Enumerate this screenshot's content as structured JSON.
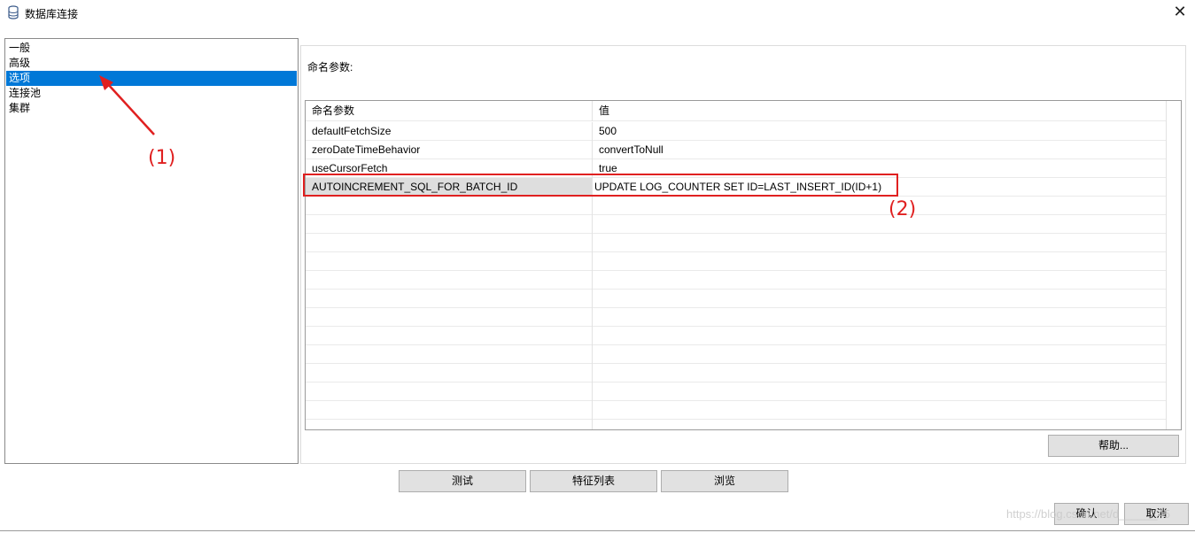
{
  "window": {
    "title": "数据库连接",
    "app_icon": "database-icon",
    "close_glyph": "✕"
  },
  "nav": {
    "items": [
      {
        "label": "一般"
      },
      {
        "label": "高级"
      },
      {
        "label": "选项",
        "selected": true
      },
      {
        "label": "连接池"
      },
      {
        "label": "集群"
      }
    ]
  },
  "options": {
    "section_label": "命名参数:",
    "columns": [
      "命名参数",
      "值"
    ],
    "rows": [
      {
        "name": "defaultFetchSize",
        "value": "500"
      },
      {
        "name": "zeroDateTimeBehavior",
        "value": "convertToNull"
      },
      {
        "name": "useCursorFetch",
        "value": "true"
      },
      {
        "name": "AUTOINCREMENT_SQL_FOR_BATCH_ID",
        "value": "UPDATE LOG_COUNTER SET ID=LAST_INSERT_ID(ID+1)"
      }
    ],
    "help_button": "帮助..."
  },
  "actions": {
    "test": "测试",
    "feature_list": "特征列表",
    "browse": "浏览",
    "ok": "确认",
    "cancel": "取消"
  },
  "annotations": {
    "label1": "(1)",
    "label2": "(2)",
    "color": "#e02020"
  },
  "watermark": "https://blog.csdn.net/d______45",
  "colors": {
    "selection": "#0078d7",
    "button": "#e1e1e1"
  }
}
